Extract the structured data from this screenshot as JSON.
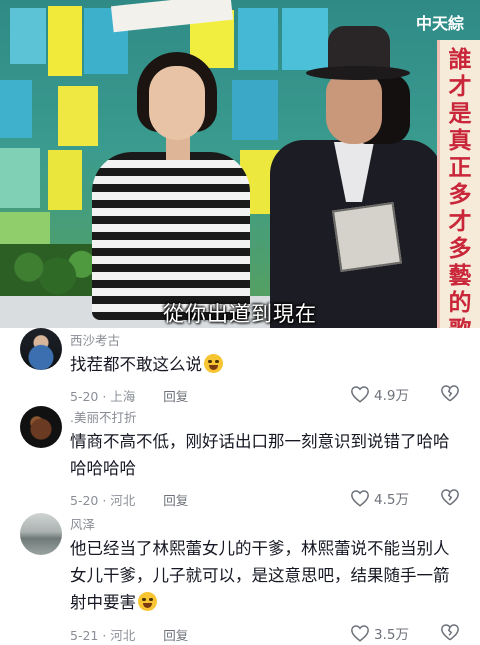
{
  "video": {
    "channel_logo": "中天綜",
    "vertical_title": "誰才是真正多才多藝的歌手?!",
    "subtitle": "從你出道到現在"
  },
  "comments": [
    {
      "username": "西沙考古",
      "text": "找茬都不敢这么说",
      "has_emoji": true,
      "date": "5-20",
      "location": "上海",
      "reply_label": "回复",
      "likes": "4.9万"
    },
    {
      "username": ".美丽不打折",
      "text_lines": [
        "情商不高不低，刚好话出口那一刻意识到说错了哈哈",
        "哈哈哈哈"
      ],
      "date": "5-20",
      "location": "河北",
      "reply_label": "回复",
      "likes": "4.5万"
    },
    {
      "username": "风泽",
      "text_lines": [
        "他已经当了林熙蕾女儿的干爹，林熙蕾说不能当别人",
        "女儿干爹，儿子就可以，是这意思吧，结果随手一箭",
        "射中要害"
      ],
      "has_emoji": true,
      "date": "5-21",
      "location": "河北",
      "reply_label": "回复",
      "likes": "3.5万"
    }
  ],
  "icons": {
    "like": "heart-outline-icon",
    "dislike": "broken-heart-icon"
  },
  "colors": {
    "text_primary": "#161823",
    "text_secondary": "#8a8f97",
    "subtitle_text": "#ffffff",
    "banner_text": "#c9263a"
  }
}
